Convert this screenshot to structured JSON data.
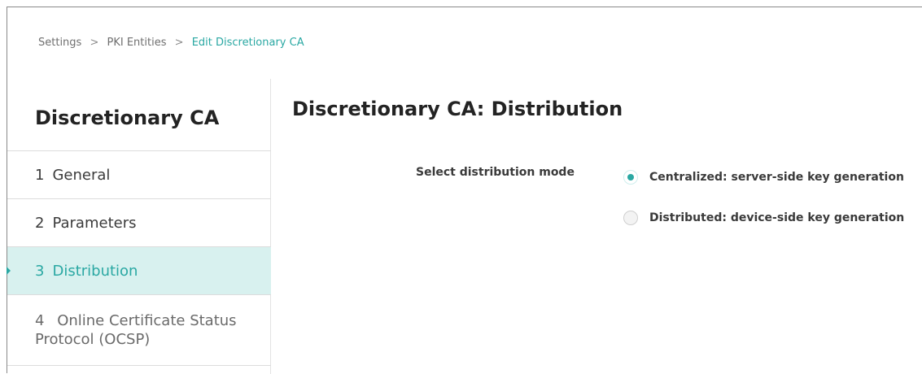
{
  "breadcrumb": {
    "items": [
      "Settings",
      "PKI Entities",
      "Edit Discretionary CA"
    ],
    "separator": ">"
  },
  "sidebar": {
    "title": "Discretionary CA",
    "items": [
      {
        "number": "1",
        "label": "General"
      },
      {
        "number": "2",
        "label": "Parameters"
      },
      {
        "number": "3",
        "label": "Distribution"
      },
      {
        "number": "4",
        "label": "Online Certificate Status Protocol (OCSP)"
      }
    ]
  },
  "main": {
    "title": "Discretionary CA: Distribution",
    "distribution_mode": {
      "label": "Select distribution mode",
      "options": [
        "Centralized: server-side key generation",
        "Distributed: device-side key generation"
      ],
      "selected": "Centralized: server-side key generation"
    }
  },
  "colors": {
    "accent": "#2aa8a3",
    "active_bg": "#d8f1ef"
  },
  "icons": {
    "active_indicator": "caret-right-icon"
  }
}
